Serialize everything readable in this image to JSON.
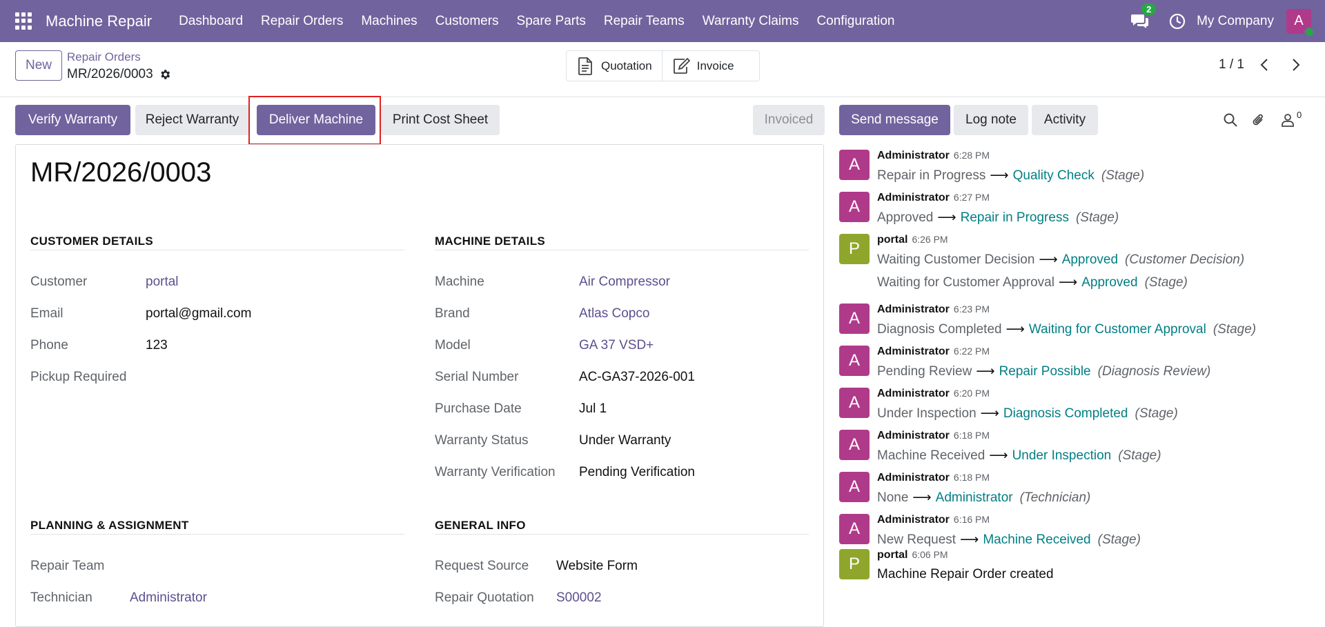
{
  "navbar": {
    "app_name": "Machine Repair",
    "menu": [
      "Dashboard",
      "Repair Orders",
      "Machines",
      "Customers",
      "Spare Parts",
      "Repair Teams",
      "Warranty Claims",
      "Configuration"
    ],
    "chat_count": "2",
    "company": "My Company",
    "user_initial": "A"
  },
  "control": {
    "new_label": "New",
    "breadcrumb": "Repair Orders",
    "record_name": "MR/2026/0003",
    "smart_buttons": [
      "Quotation",
      "Invoice"
    ],
    "pager": "1 / 1"
  },
  "statusbar": {
    "buttons": [
      "Verify Warranty",
      "Reject Warranty",
      "Deliver Machine",
      "Print Cost Sheet"
    ],
    "state": "Invoiced"
  },
  "form": {
    "title": "MR/2026/0003",
    "customer_details": {
      "heading": "CUSTOMER DETAILS",
      "customer_label": "Customer",
      "customer": "portal",
      "email_label": "Email",
      "email": "portal@gmail.com",
      "phone_label": "Phone",
      "phone": "123",
      "pickup_label": "Pickup Required"
    },
    "machine_details": {
      "heading": "MACHINE DETAILS",
      "machine_label": "Machine",
      "machine": "Air Compressor",
      "brand_label": "Brand",
      "brand": "Atlas Copco",
      "model_label": "Model",
      "model": "GA 37 VSD+",
      "serial_label": "Serial Number",
      "serial": "AC-GA37-2026-001",
      "purchase_label": "Purchase Date",
      "purchase": "Jul 1",
      "warranty_status_label": "Warranty Status",
      "warranty_status": "Under Warranty",
      "warranty_verif_label": "Warranty Verification",
      "warranty_verif": "Pending Verification"
    },
    "planning": {
      "heading": "PLANNING & ASSIGNMENT",
      "team_label": "Repair Team",
      "tech_label": "Technician",
      "tech": "Administrator"
    },
    "general": {
      "heading": "GENERAL INFO",
      "source_label": "Request Source",
      "source": "Website Form",
      "quotation_label": "Repair Quotation",
      "quotation": "S00002"
    }
  },
  "chatter": {
    "send_label": "Send message",
    "log_label": "Log note",
    "activity_label": "Activity",
    "followers": "0",
    "messages": [
      {
        "initial": "A",
        "author": "Administrator",
        "time": "6:28 PM",
        "old": "Repair in Progress",
        "new": "Quality Check",
        "field": "(Stage)"
      },
      {
        "initial": "A",
        "author": "Administrator",
        "time": "6:27 PM",
        "old": "Approved",
        "new": "Repair in Progress",
        "field": "(Stage)"
      },
      {
        "initial": "P",
        "author": "portal",
        "time": "6:26 PM",
        "old": "Waiting Customer Decision",
        "new": "Approved",
        "field": "(Customer Decision)",
        "old2": "Waiting for Customer Approval",
        "new2": "Approved",
        "field2": "(Stage)"
      },
      {
        "initial": "A",
        "author": "Administrator",
        "time": "6:23 PM",
        "old": "Diagnosis Completed",
        "new": "Waiting for Customer Approval",
        "field": "(Stage)"
      },
      {
        "initial": "A",
        "author": "Administrator",
        "time": "6:22 PM",
        "old": "Pending Review",
        "new": "Repair Possible",
        "field": "(Diagnosis Review)"
      },
      {
        "initial": "A",
        "author": "Administrator",
        "time": "6:20 PM",
        "old": "Under Inspection",
        "new": "Diagnosis Completed",
        "field": "(Stage)"
      },
      {
        "initial": "A",
        "author": "Administrator",
        "time": "6:18 PM",
        "old": "Machine Received",
        "new": "Under Inspection",
        "field": "(Stage)"
      },
      {
        "initial": "A",
        "author": "Administrator",
        "time": "6:18 PM",
        "old": "None",
        "new": "Administrator",
        "field": "(Technician)"
      },
      {
        "initial": "A",
        "author": "Administrator",
        "time": "6:16 PM",
        "old": "New Request",
        "new": "Machine Received",
        "field": "(Stage)"
      },
      {
        "initial": "P",
        "author": "portal",
        "time": "6:06 PM",
        "body": "Machine Repair Order created"
      }
    ]
  },
  "colors": {
    "brand": "#71639e",
    "link": "#017e84",
    "highlight": "#e02020",
    "avatar_a": "#b03a8a",
    "avatar_p": "#8fa62c"
  }
}
